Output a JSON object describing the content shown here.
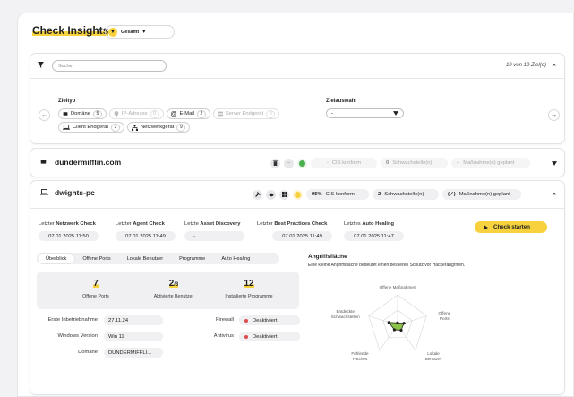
{
  "header": {
    "title": "Check Insights",
    "scope_badge": "▼",
    "scope_label": "Gesamt",
    "scope_caret": "▾"
  },
  "filter": {
    "search_placeholder": "Suche",
    "count_text": "19 von 19 Ziel(e)",
    "zieltyp_label": "Zieltyp",
    "zielauswahl_label": "Zielauswahl",
    "zielauswahl_value": "-",
    "types": [
      {
        "label": "Domäne",
        "count": "5",
        "dim": false
      },
      {
        "label": "IP-Adresse",
        "count": "0",
        "dim": true
      },
      {
        "label": "E-Mail",
        "count": "2",
        "dim": false
      },
      {
        "label": "Server Endgerät",
        "count": "0",
        "dim": true
      },
      {
        "label": "Client Endgerät",
        "count": "3",
        "dim": false
      },
      {
        "label": "Netzwerkgerät",
        "count": "9",
        "dim": false
      }
    ]
  },
  "domain_card": {
    "name": "dundermifflin.com",
    "dash": "–",
    "cis_value": "-",
    "cis_label": "CIS konform",
    "vuln_count": "0",
    "vuln_label": "Schwachstelle(n)",
    "measure_count": "–",
    "measure_label": "Maßnahme(n) geplant"
  },
  "device_card": {
    "name": "dwights-pc",
    "cis_value": "95%",
    "cis_label": "CIS konform",
    "vuln_count": "2",
    "vuln_label": "Schwachstelle(n)",
    "measure_count": "(✓)",
    "measure_label": "Maßnahme(n) geplant",
    "checks": [
      {
        "prefix": "Letzter",
        "bold": "Netzwerk Check",
        "value": "07.01.2025  11:50"
      },
      {
        "prefix": "Letzter",
        "bold": "Agent Check",
        "value": "07.01.2025  11:49"
      },
      {
        "prefix": "Letzte",
        "bold": "Asset Discovery",
        "value": "-"
      },
      {
        "prefix": "Letzter",
        "bold": "Best Practices Check",
        "value": "07.01.2025  11:49"
      },
      {
        "prefix": "Letztes",
        "bold": "Auto Healing",
        "value": "07.01.2025  11:47"
      }
    ],
    "start_button": "Check starten",
    "tabs": [
      "Überblick",
      "Offene Ports",
      "Lokale Benutzer",
      "Programme",
      "Auto Healing"
    ],
    "stats": [
      {
        "num": "7",
        "sub": "",
        "label": "Offene Ports"
      },
      {
        "num": "2",
        "sub": "/3",
        "label": "Aktivierte Benutzer"
      },
      {
        "num": "12",
        "sub": "",
        "label": "Installierte Programme"
      }
    ],
    "info": {
      "first_label": "Erste Inbetriebnahme",
      "first_value": "27.11.24",
      "os_label": "Windows Version",
      "os_value": "Win 11",
      "domain_label": "Domäne",
      "domain_value": "DUNDERMIFFLI...",
      "firewall_label": "Firewall",
      "firewall_value": "Deaktiviert",
      "antivirus_label": "Antivirus",
      "antivirus_value": "Deaktiviert"
    },
    "attack": {
      "title": "Angriffsfläche",
      "subtitle": "Eine kleine Angriffsfläche bedeutet einen besseren Schutz vor Hackerangriffen.",
      "axes": [
        "Offene Maßnahmen",
        "Offene\nPorts",
        "Lokale\nBenutzer",
        "Fehlende\nPatches",
        "Entdeckte\nSchwachstellen"
      ],
      "values": [
        0.08,
        0.22,
        0.2,
        0.18,
        0.3
      ],
      "fill_color": "#8bc34a"
    }
  },
  "colors": {
    "accent": "#f7d23e",
    "green": "#4caf50",
    "red": "#e04a4a"
  }
}
